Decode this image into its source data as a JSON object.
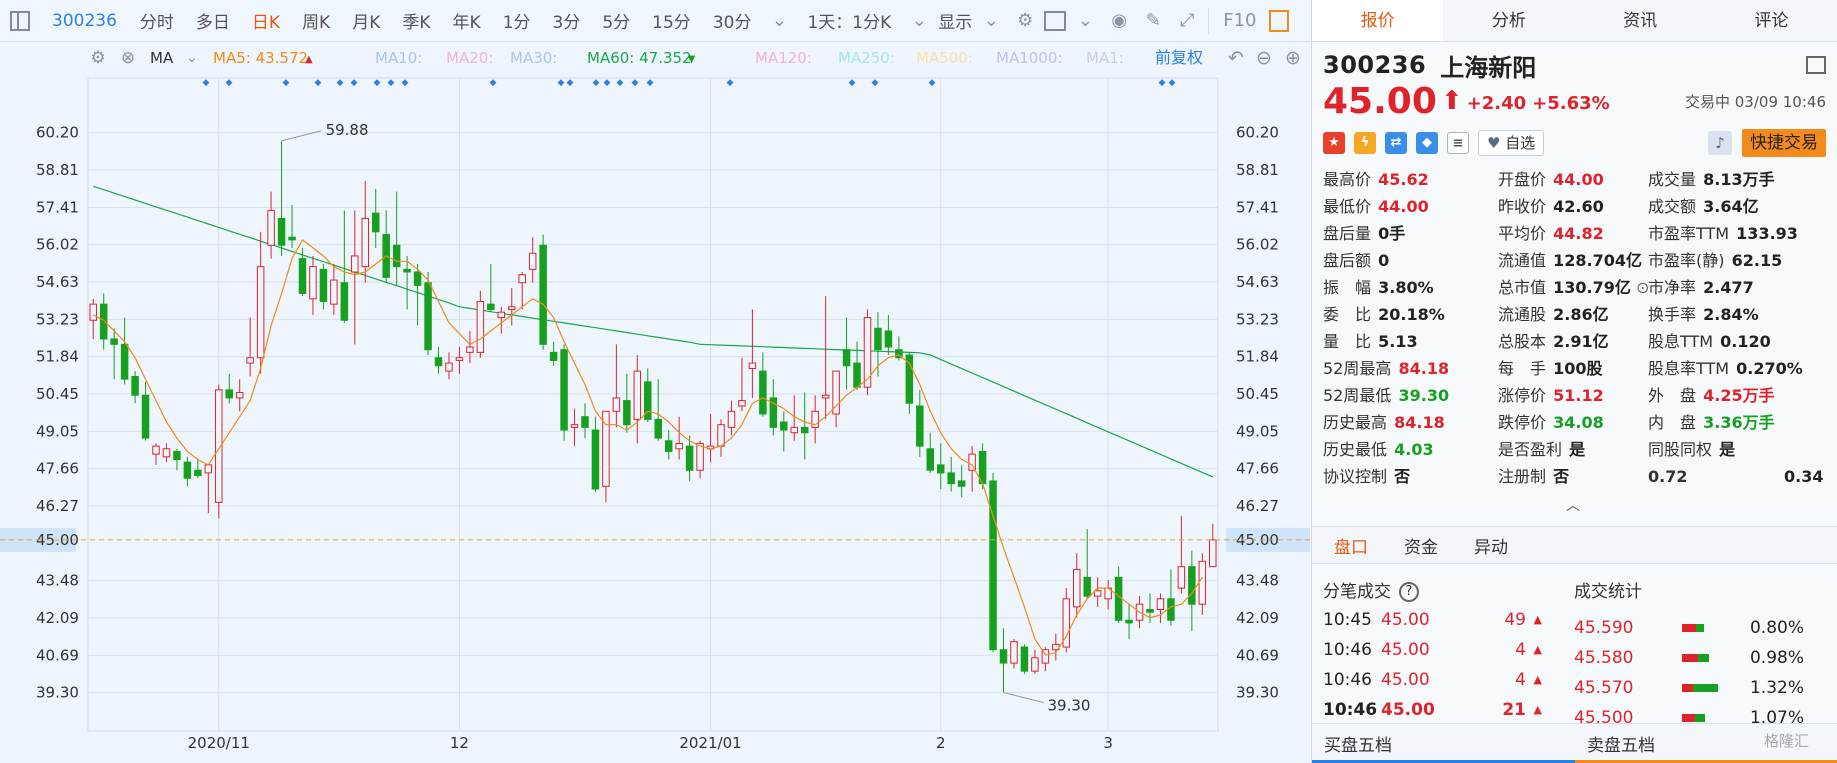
{
  "toolbar": {
    "code": "300236",
    "periods": [
      "分时",
      "多日",
      "日K",
      "周K",
      "月K",
      "季K",
      "年K",
      "1分",
      "3分",
      "5分",
      "15分",
      "30分"
    ],
    "active_period": "日K",
    "interval": "1天：1分K",
    "display": "显示",
    "f10": "F10"
  },
  "ma_bar": {
    "label": "MA",
    "items": [
      {
        "name": "MA5:",
        "value": "43.572",
        "color": "#f08c1a",
        "dir": "▲"
      },
      {
        "name": "MA10:",
        "value": "",
        "color": "#a9c6ee",
        "dir": ""
      },
      {
        "name": "MA20:",
        "value": "",
        "color": "#f2b7c9",
        "dir": ""
      },
      {
        "name": "MA30:",
        "value": "",
        "color": "#a9c6ee",
        "dir": ""
      },
      {
        "name": "MA60:",
        "value": "47.352",
        "color": "#19a84c",
        "dir": "▼"
      },
      {
        "name": "MA120:",
        "value": "",
        "color": "#f2b7c9",
        "dir": ""
      },
      {
        "name": "MA250:",
        "value": "",
        "color": "#a8e4ee",
        "dir": ""
      },
      {
        "name": "MA500:",
        "value": "",
        "color": "#f5e4a9",
        "dir": ""
      },
      {
        "name": "MA1000:",
        "value": "",
        "color": "#b6c6ea",
        "dir": ""
      },
      {
        "name": "MA1:",
        "value": "",
        "color": "#c6d0e2",
        "dir": ""
      }
    ],
    "restore": "前复权"
  },
  "chart_data": {
    "type": "candlestick",
    "y_ticks": [
      "60.20",
      "58.81",
      "57.41",
      "56.02",
      "54.63",
      "53.23",
      "51.84",
      "50.45",
      "49.05",
      "47.66",
      "46.27",
      "45.00",
      "43.48",
      "42.09",
      "40.69",
      "39.30"
    ],
    "ylim": [
      38.5,
      60.6
    ],
    "x_labels": [
      {
        "label": "2020/11",
        "i": 12
      },
      {
        "label": "12",
        "i": 35
      },
      {
        "label": "2021/01",
        "i": 59
      },
      {
        "label": "2",
        "i": 81
      },
      {
        "label": "3",
        "i": 97
      }
    ],
    "current_price": 45.0,
    "high_annotation": "59.88",
    "low_annotation": "39.30",
    "candles": [
      [
        53.2,
        54.0,
        52.5,
        53.8
      ],
      [
        53.8,
        54.2,
        52.1,
        52.5
      ],
      [
        52.5,
        52.9,
        51.0,
        52.3
      ],
      [
        52.3,
        53.3,
        50.8,
        51.0
      ],
      [
        51.1,
        51.3,
        50.1,
        50.4
      ],
      [
        50.4,
        50.9,
        48.7,
        48.8
      ],
      [
        48.2,
        48.6,
        47.8,
        48.5
      ],
      [
        48.1,
        48.6,
        47.9,
        48.4
      ],
      [
        48.3,
        48.4,
        47.6,
        48.0
      ],
      [
        47.9,
        48.1,
        47.0,
        47.3
      ],
      [
        47.6,
        48.0,
        47.3,
        47.4
      ],
      [
        47.5,
        47.8,
        46.0,
        47.8
      ],
      [
        46.4,
        50.8,
        45.8,
        50.6
      ],
      [
        50.6,
        51.2,
        50.1,
        50.3
      ],
      [
        50.3,
        51.0,
        49.8,
        50.5
      ],
      [
        51.6,
        53.3,
        51.1,
        51.8
      ],
      [
        51.8,
        56.5,
        51.2,
        55.2
      ],
      [
        56.0,
        58.0,
        55.5,
        57.3
      ],
      [
        57.0,
        59.9,
        55.6,
        56.0
      ],
      [
        56.3,
        57.5,
        55.9,
        56.2
      ],
      [
        55.5,
        55.9,
        54.1,
        54.2
      ],
      [
        54.0,
        55.6,
        53.4,
        55.2
      ],
      [
        55.1,
        55.3,
        53.6,
        53.9
      ],
      [
        53.8,
        55.3,
        53.4,
        54.7
      ],
      [
        54.6,
        57.3,
        53.1,
        53.2
      ],
      [
        55.0,
        57.3,
        52.3,
        55.6
      ],
      [
        55.2,
        58.4,
        54.6,
        57.0
      ],
      [
        57.2,
        58.1,
        55.9,
        56.5
      ],
      [
        56.4,
        57.3,
        54.6,
        54.8
      ],
      [
        56.0,
        58.0,
        54.5,
        55.2
      ],
      [
        55.1,
        55.6,
        53.6,
        55.0
      ],
      [
        55.0,
        55.3,
        53.0,
        54.5
      ],
      [
        54.6,
        55.0,
        51.9,
        52.1
      ],
      [
        51.8,
        52.2,
        51.2,
        51.5
      ],
      [
        51.3,
        52.0,
        51.0,
        51.6
      ],
      [
        51.7,
        52.2,
        51.2,
        51.8
      ],
      [
        52.0,
        52.8,
        51.6,
        52.2
      ],
      [
        52.0,
        54.3,
        51.8,
        53.9
      ],
      [
        53.8,
        55.3,
        53.5,
        53.6
      ],
      [
        53.3,
        53.7,
        52.7,
        53.5
      ],
      [
        53.6,
        54.4,
        53.0,
        53.7
      ],
      [
        54.6,
        55.0,
        53.6,
        54.9
      ],
      [
        55.1,
        56.3,
        54.6,
        55.7
      ],
      [
        56.0,
        56.4,
        52.1,
        52.3
      ],
      [
        52.0,
        52.4,
        51.5,
        51.7
      ],
      [
        52.1,
        52.3,
        48.7,
        49.1
      ],
      [
        49.2,
        49.9,
        48.5,
        49.3
      ],
      [
        49.6,
        50.1,
        48.8,
        49.2
      ],
      [
        49.1,
        49.6,
        46.8,
        46.9
      ],
      [
        47.0,
        49.8,
        46.4,
        49.8
      ],
      [
        49.8,
        52.3,
        49.2,
        50.3
      ],
      [
        50.2,
        51.2,
        49.0,
        49.3
      ],
      [
        49.5,
        51.9,
        48.6,
        51.3
      ],
      [
        50.9,
        51.4,
        49.4,
        49.5
      ],
      [
        49.5,
        51.0,
        48.7,
        48.8
      ],
      [
        48.7,
        49.1,
        48.0,
        48.3
      ],
      [
        48.4,
        49.6,
        48.0,
        48.6
      ],
      [
        48.5,
        48.9,
        47.2,
        47.6
      ],
      [
        47.6,
        48.7,
        47.3,
        48.6
      ],
      [
        48.4,
        49.7,
        47.9,
        48.5
      ],
      [
        48.5,
        49.5,
        48.1,
        49.3
      ],
      [
        49.2,
        50.2,
        48.9,
        49.8
      ],
      [
        50.0,
        51.8,
        49.8,
        50.2
      ],
      [
        51.4,
        53.6,
        50.3,
        51.6
      ],
      [
        51.3,
        52.0,
        49.6,
        49.7
      ],
      [
        50.3,
        51.0,
        48.9,
        49.2
      ],
      [
        49.4,
        49.8,
        48.3,
        49.1
      ],
      [
        49.0,
        50.4,
        48.7,
        49.2
      ],
      [
        49.2,
        50.5,
        48.0,
        49.0
      ],
      [
        49.2,
        50.4,
        48.6,
        49.8
      ],
      [
        50.3,
        54.1,
        49.5,
        50.4
      ],
      [
        49.7,
        51.3,
        49.2,
        51.3
      ],
      [
        52.1,
        53.3,
        50.6,
        51.5
      ],
      [
        51.6,
        52.4,
        50.6,
        50.7
      ],
      [
        50.7,
        53.6,
        50.4,
        53.3
      ],
      [
        52.9,
        53.5,
        51.1,
        52.1
      ],
      [
        52.8,
        53.4,
        51.9,
        52.2
      ],
      [
        52.1,
        52.6,
        51.7,
        51.8
      ],
      [
        51.9,
        52.0,
        49.7,
        50.1
      ],
      [
        50.0,
        50.6,
        48.1,
        48.5
      ],
      [
        48.4,
        49.0,
        47.5,
        47.6
      ],
      [
        47.8,
        48.6,
        46.9,
        47.5
      ],
      [
        47.5,
        48.1,
        46.8,
        47.1
      ],
      [
        47.2,
        47.8,
        46.6,
        47.0
      ],
      [
        47.6,
        48.5,
        46.8,
        48.2
      ],
      [
        48.3,
        48.6,
        46.9,
        47.1
      ],
      [
        47.2,
        47.5,
        40.8,
        40.9
      ],
      [
        40.9,
        41.7,
        39.3,
        40.4
      ],
      [
        40.4,
        41.3,
        40.2,
        41.2
      ],
      [
        41.0,
        41.1,
        40.0,
        40.1
      ],
      [
        40.1,
        40.9,
        40.0,
        40.6
      ],
      [
        40.4,
        41.0,
        40.1,
        40.9
      ],
      [
        40.9,
        41.5,
        40.5,
        41.1
      ],
      [
        41.0,
        43.2,
        40.8,
        42.8
      ],
      [
        42.5,
        44.5,
        42.1,
        43.9
      ],
      [
        43.6,
        45.4,
        42.8,
        42.9
      ],
      [
        42.9,
        43.6,
        42.5,
        43.1
      ],
      [
        42.8,
        43.5,
        42.4,
        43.2
      ],
      [
        43.6,
        44.0,
        41.9,
        42.0
      ],
      [
        42.0,
        42.6,
        41.3,
        41.9
      ],
      [
        42.0,
        42.9,
        41.7,
        42.6
      ],
      [
        42.4,
        43.0,
        41.9,
        42.3
      ],
      [
        42.4,
        43.0,
        41.9,
        42.8
      ],
      [
        42.8,
        43.9,
        41.8,
        42.0
      ],
      [
        43.2,
        45.9,
        43.0,
        44.0
      ],
      [
        44.0,
        44.6,
        41.6,
        42.6
      ],
      [
        42.6,
        44.5,
        42.2,
        44.2
      ],
      [
        44.0,
        45.6,
        44.0,
        45.0
      ]
    ],
    "ma5": [
      53.4,
      53.2,
      52.8,
      52.4,
      51.8,
      51.0,
      50.2,
      49.4,
      48.8,
      48.3,
      48.0,
      47.8,
      48.4,
      49.0,
      49.6,
      50.2,
      51.4,
      53.0,
      54.2,
      55.5,
      56.2,
      55.9,
      55.6,
      55.2,
      55.0,
      54.9,
      55.0,
      55.3,
      55.6,
      55.4,
      55.4,
      55.1,
      54.7,
      53.9,
      53.1,
      52.7,
      52.3,
      52.5,
      52.8,
      53.1,
      53.4,
      53.7,
      54.0,
      53.8,
      53.3,
      52.4,
      51.6,
      50.8,
      49.8,
      49.3,
      49.3,
      49.1,
      49.4,
      49.8,
      49.7,
      49.4,
      49.0,
      48.7,
      48.5,
      48.4,
      48.5,
      48.8,
      49.3,
      50.1,
      50.3,
      50.1,
      49.9,
      49.6,
      49.4,
      49.3,
      49.6,
      50.0,
      50.4,
      50.7,
      51.0,
      51.5,
      51.8,
      51.9,
      51.6,
      50.8,
      49.8,
      49.0,
      48.4,
      48.0,
      47.8,
      47.1,
      45.9,
      44.7,
      43.6,
      42.5,
      41.3,
      40.7,
      40.8,
      41.4,
      42.2,
      42.8,
      43.2,
      43.2,
      42.9,
      42.6,
      42.3,
      42.1,
      42.2,
      42.5,
      42.6,
      43.0,
      43.6
    ]
  },
  "right": {
    "tabs": [
      "报价",
      "分析",
      "资讯",
      "评论"
    ],
    "active_tab": "报价",
    "code": "300236",
    "name": "上海新阳",
    "price": "45.00",
    "change": "+2.40",
    "pct": "+5.63%",
    "status": "交易中 03/09 10:46",
    "favorite": "自选",
    "quick_trade": "快捷交易",
    "col1": [
      {
        "k": "最高价",
        "v": "45.62",
        "c": "red"
      },
      {
        "k": "最低价",
        "v": "44.00",
        "c": "red"
      },
      {
        "k": "盘后量",
        "v": "0手",
        "c": "dark"
      },
      {
        "k": "盘后额",
        "v": "0",
        "c": "dark"
      },
      {
        "k": "振　幅",
        "v": "3.80%",
        "c": "dark"
      },
      {
        "k": "委　比",
        "v": "20.18%",
        "c": "dark"
      },
      {
        "k": "量　比",
        "v": "5.13",
        "c": "dark"
      },
      {
        "k": "52周最高",
        "v": "84.18",
        "c": "red"
      },
      {
        "k": "52周最低",
        "v": "39.30",
        "c": "green"
      },
      {
        "k": "历史最高",
        "v": "84.18",
        "c": "red"
      },
      {
        "k": "历史最低",
        "v": "4.03",
        "c": "green"
      },
      {
        "k": "协议控制",
        "v": "否",
        "c": "dark"
      }
    ],
    "col2": [
      {
        "k": "开盘价",
        "v": "44.00",
        "c": "red"
      },
      {
        "k": "昨收价",
        "v": "42.60",
        "c": "dark"
      },
      {
        "k": "平均价",
        "v": "44.82",
        "c": "red"
      },
      {
        "k": "流通值",
        "v": "128.704亿",
        "c": "dark"
      },
      {
        "k": "总市值",
        "v": "130.79亿",
        "c": "dark"
      },
      {
        "k": "流通股",
        "v": "2.86亿",
        "c": "dark"
      },
      {
        "k": "总股本",
        "v": "2.91亿",
        "c": "dark"
      },
      {
        "k": "每　手",
        "v": "100股",
        "c": "dark"
      },
      {
        "k": "涨停价",
        "v": "51.12",
        "c": "red"
      },
      {
        "k": "跌停价",
        "v": "34.08",
        "c": "green"
      },
      {
        "k": "是否盈利",
        "v": "是",
        "c": "dark"
      },
      {
        "k": "注册制",
        "v": "否",
        "c": "dark"
      }
    ],
    "col3": [
      {
        "k": "成交量",
        "v": "8.13万手",
        "c": "dark"
      },
      {
        "k": "成交额",
        "v": "3.64亿",
        "c": "dark"
      },
      {
        "k": "市盈率TTM",
        "v": "133.93",
        "c": "dark"
      },
      {
        "k": "市盈率(静)",
        "v": "62.15",
        "c": "dark"
      },
      {
        "k": "市净率",
        "v": "2.477",
        "c": "dark"
      },
      {
        "k": "换手率",
        "v": "2.84%",
        "c": "dark"
      },
      {
        "k": "股息TTM",
        "v": "0.120",
        "c": "dark"
      },
      {
        "k": "股息率TTM",
        "v": "0.270%",
        "c": "dark"
      },
      {
        "k": "外　盘",
        "v": "4.25万手",
        "c": "red"
      },
      {
        "k": "内　盘",
        "v": "3.36万手",
        "c": "green"
      },
      {
        "k": "同股同权",
        "v": "是",
        "c": "dark"
      },
      {
        "k": "0.72",
        "v": "0.34",
        "c": "dark"
      }
    ],
    "bottom_tabs": [
      "盘口",
      "资金",
      "异动"
    ],
    "trade_title": "分笔成交",
    "stat_title": "成交统计",
    "trades": [
      {
        "t": "10:45",
        "p": "45.00",
        "q": "49"
      },
      {
        "t": "10:46",
        "p": "45.00",
        "q": "4"
      },
      {
        "t": "10:46",
        "p": "45.00",
        "q": "4"
      },
      {
        "t": "10:46",
        "p": "45.00",
        "q": "21"
      }
    ],
    "stats": [
      {
        "p": "45.590",
        "pct": "0.80%",
        "r": 0.4,
        "g": 0.2
      },
      {
        "p": "45.580",
        "pct": "0.98%",
        "r": 0.45,
        "g": 0.3
      },
      {
        "p": "45.570",
        "pct": "1.32%",
        "r": 0.3,
        "g": 0.7
      },
      {
        "p": "45.500",
        "pct": "1.07%",
        "r": 0.35,
        "g": 0.3
      }
    ],
    "footer": [
      "买盘五档",
      "卖盘五档"
    ],
    "watermark": "格隆汇"
  }
}
